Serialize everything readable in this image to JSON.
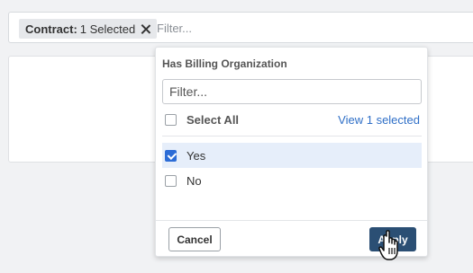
{
  "filter_bar": {
    "chip": {
      "key": "Contract:",
      "value": "1 Selected"
    },
    "placeholder": "Filter..."
  },
  "popover": {
    "title": "Has Billing Organization",
    "filter_placeholder": "Filter...",
    "select_all": {
      "label": "Select All",
      "checked": false
    },
    "view_selected_link": "View 1 selected",
    "options": [
      {
        "label": "Yes",
        "checked": true
      },
      {
        "label": "No",
        "checked": false
      }
    ],
    "cancel_label": "Cancel",
    "apply_label": "Apply"
  },
  "colors": {
    "accent": "#2c6cd6",
    "link": "#2f6fc7",
    "apply_button": "#2b4f74",
    "selected_row": "#e6eefa"
  },
  "icons": {
    "chip_remove": "close-icon",
    "pointer": "hand-pointer-icon"
  }
}
